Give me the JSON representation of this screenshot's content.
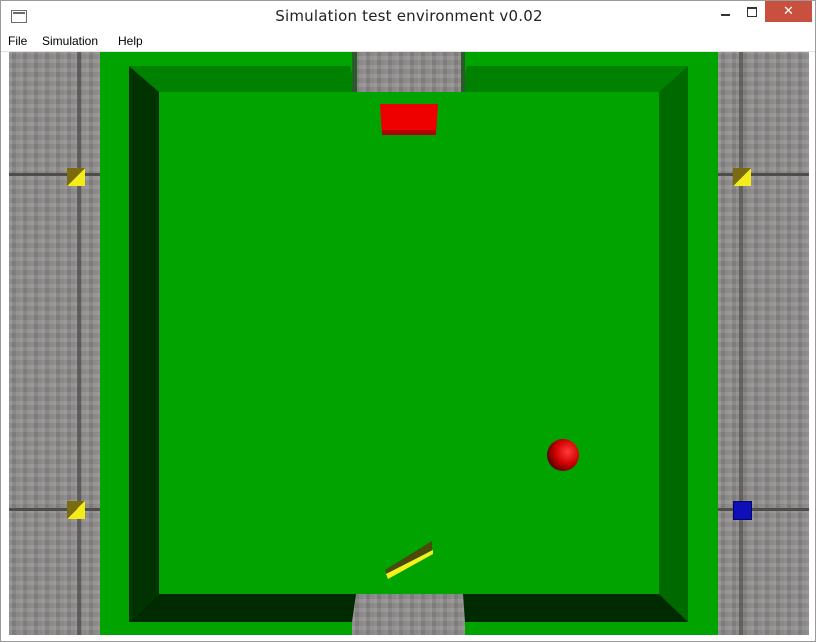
{
  "window": {
    "title": "Simulation test environment v0.02"
  },
  "window_controls": {
    "minimize": "minimize",
    "maximize": "maximize",
    "close": "✕"
  },
  "menu": {
    "items": [
      "File",
      "Simulation",
      "Help"
    ]
  },
  "scene": {
    "colors": {
      "field": "#00a300",
      "wall_top": "#008200",
      "wall_shadow": "#003300",
      "goal": "#ee0000",
      "ball": "#dd0000",
      "robot_top": "#4b4a09",
      "robot_edge": "#f6f11c",
      "corner_marker": "#f4ec1a",
      "blue_marker": "#0d0fb8"
    },
    "corner_markers": [
      "yellow",
      "yellow",
      "yellow",
      "blue"
    ]
  }
}
